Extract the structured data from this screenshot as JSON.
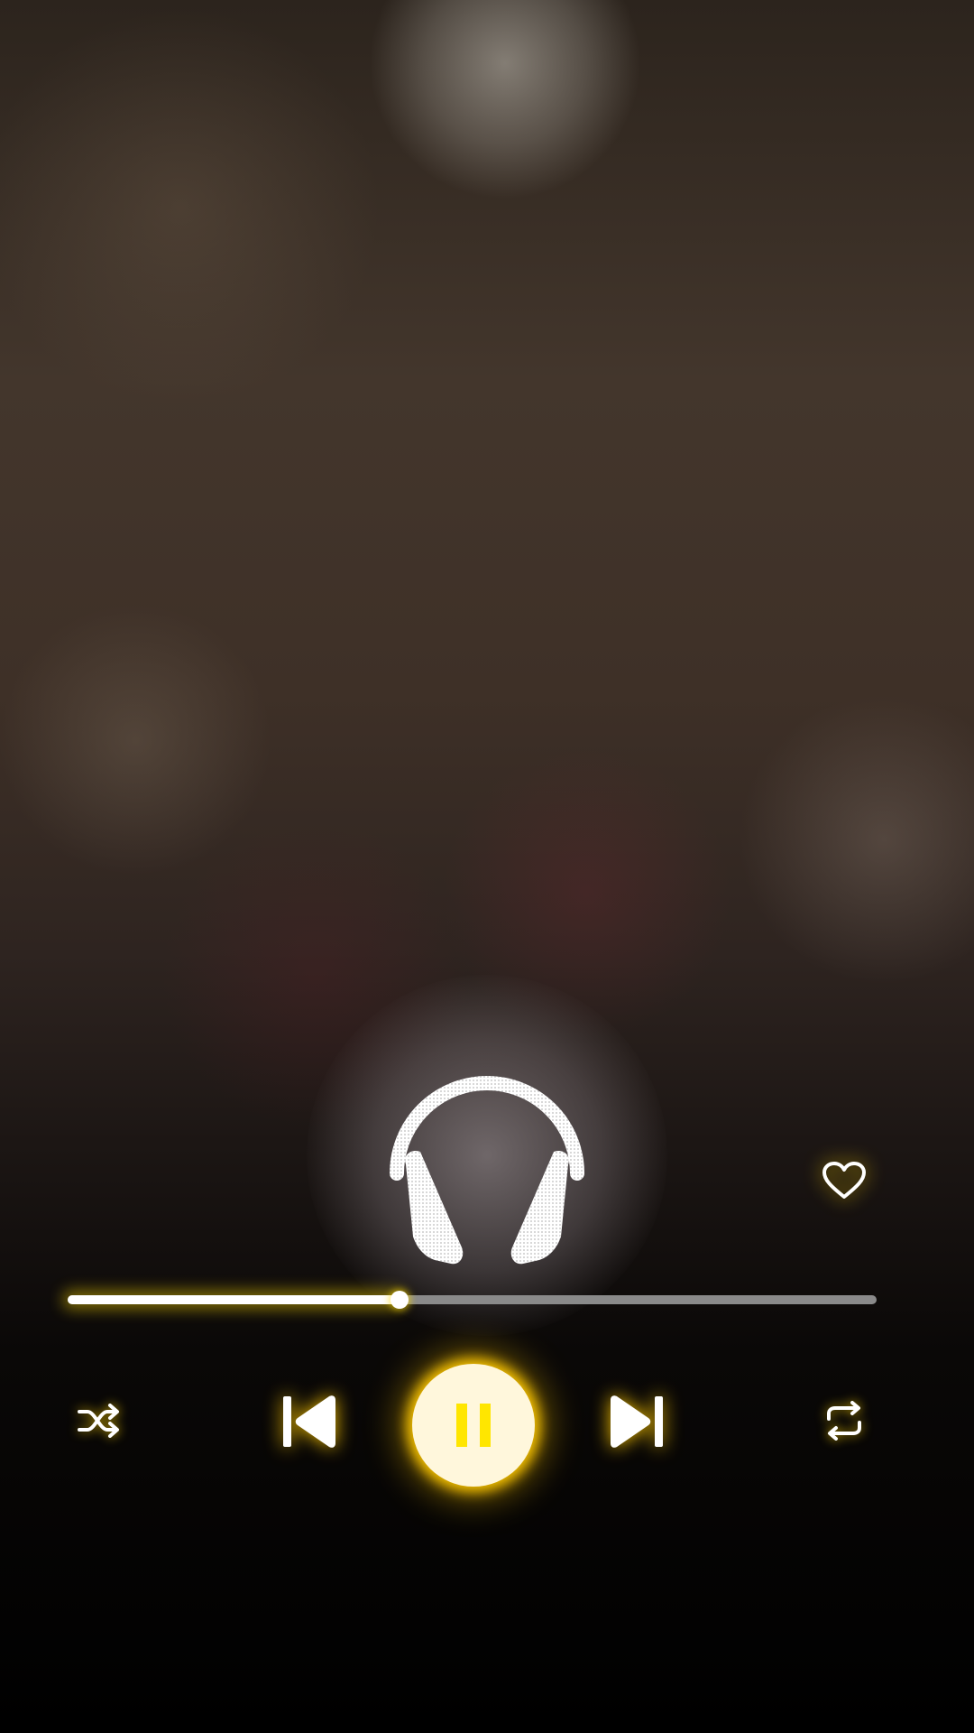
{
  "player": {
    "state": "playing",
    "progress_fraction": 0.41,
    "favorited": false
  },
  "icons": {
    "album_art": "headphones-icon",
    "favorite": "heart-icon",
    "shuffle": "shuffle-icon",
    "previous": "skip-previous-icon",
    "play_pause": "pause-icon",
    "next": "skip-next-icon",
    "repeat": "repeat-icon"
  },
  "colors": {
    "accent_glow": "#FFD400",
    "pause_bars": "#FFE600",
    "icon": "#FFFFFF",
    "track_filled": "#FFFFFF",
    "track_empty": "#8A8A8A"
  }
}
